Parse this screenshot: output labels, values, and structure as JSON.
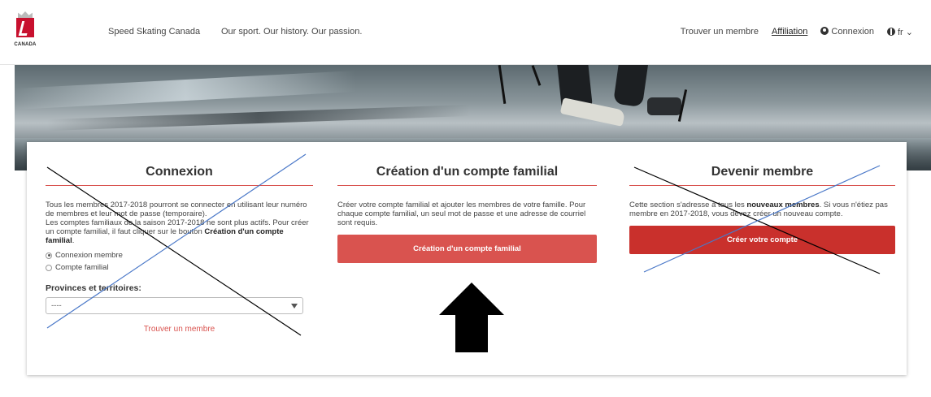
{
  "nav": {
    "logo_text": "CANADA",
    "brand": "Speed Skating Canada",
    "tagline": "Our sport. Our history. Our passion.",
    "find_member": "Trouver un membre",
    "affiliation": "Affiliation",
    "login": "Connexion",
    "language": "fr",
    "language_caret": "⌄",
    "icons": {
      "login": "user-circle-icon",
      "language": "globe-icon"
    }
  },
  "login_col": {
    "title": "Connexion",
    "text_1": "Tous les membres 2017-2018 pourront se connecter en utilisant leur numéro de membres et leur mot de passe (temporaire).",
    "text_2": "Les comptes familiaux de la saison 2017-2018 ne sont plus actifs. Pour créer un compte familial, il faut cliquer sur le bouton",
    "text_2_bold": "Création d'un compte familial",
    "text_2_end": ".",
    "radio_member": "Connexion membre",
    "radio_family": "Compte familial",
    "selected_radio": "Connexion membre",
    "provinces_label": "Provinces et territoires:",
    "provinces_value": "----",
    "find_member_link": "Trouver un membre"
  },
  "family_col": {
    "title": "Création d'un compte familial",
    "text": "Créer votre compte familial et ajouter les membres de votre famille. Pour chaque compte familial, un seul mot de passe et une adresse de courriel sont requis.",
    "button": "Création d'un compte familial"
  },
  "member_col": {
    "title": "Devenir membre",
    "text_start": "Cette section s'adresse à tous les",
    "text_bold": "nouveaux membres",
    "text_end": ". Si vous n'étiez pas membre en 2017-2018, vous devez créer un nouveau compte.",
    "button": "Créer votre compte"
  },
  "colors": {
    "accent": "#d9534f",
    "button_dark": "#c9302c",
    "annotation_blue": "#4a78c8",
    "annotation_black": "#000000"
  }
}
